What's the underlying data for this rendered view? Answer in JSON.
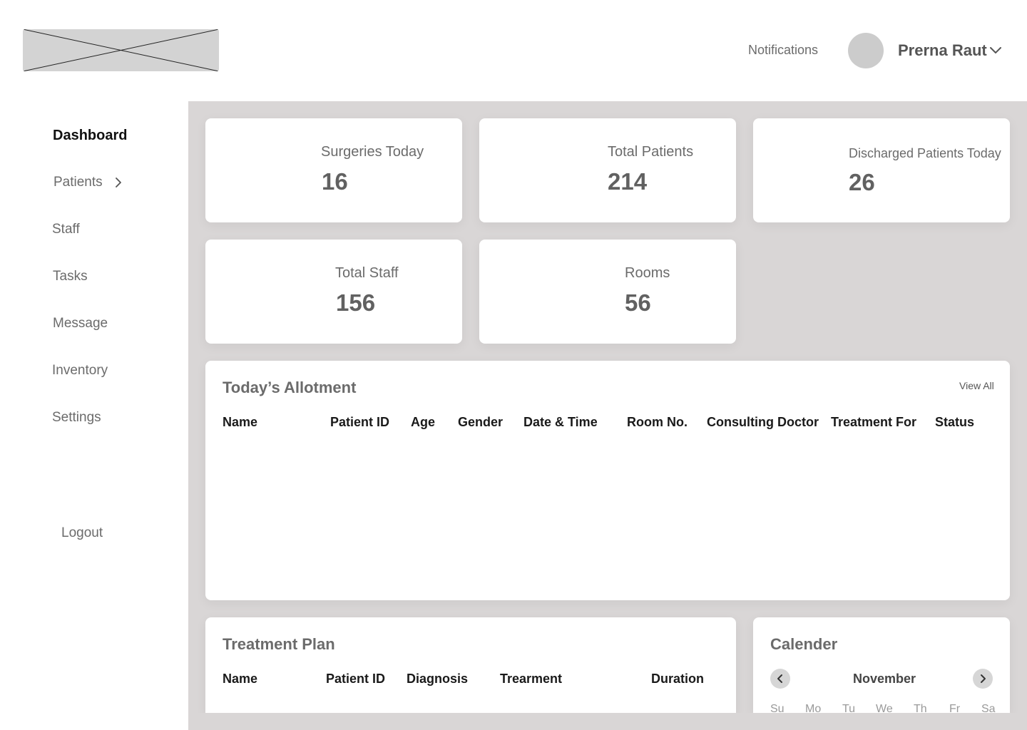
{
  "header": {
    "notifications_label": "Notifications",
    "user_name": "Prerna Raut"
  },
  "sidebar": {
    "items": [
      {
        "label": "Dashboard",
        "active": true
      },
      {
        "label": "Patients",
        "has_submenu": true
      },
      {
        "label": "Staff"
      },
      {
        "label": "Tasks"
      },
      {
        "label": "Message"
      },
      {
        "label": "Inventory"
      },
      {
        "label": "Settings"
      }
    ],
    "logout_label": "Logout"
  },
  "stats": [
    {
      "label": "Surgeries Today",
      "value": "16"
    },
    {
      "label": "Total Patients",
      "value": "214"
    },
    {
      "label": "Discharged Patients Today",
      "value": "26"
    },
    {
      "label": "Total Staff",
      "value": "156"
    },
    {
      "label": "Rooms",
      "value": "56"
    }
  ],
  "allotment": {
    "title": "Today’s Allotment",
    "view_all_label": "View All",
    "columns": [
      "Name",
      "Patient ID",
      "Age",
      "Gender",
      "Date & Time",
      "Room No.",
      "Consulting Doctor",
      "Treatment For",
      "Status"
    ]
  },
  "treatment_plan": {
    "title": "Treatment Plan",
    "columns": [
      "Name",
      "Patient ID",
      "Diagnosis",
      "Trearment",
      "Duration"
    ]
  },
  "calendar": {
    "title": "Calender",
    "month": "November",
    "weekdays": [
      "Su",
      "Mo",
      "Tu",
      "We",
      "Th",
      "Fr",
      "Sa"
    ]
  },
  "colors": {
    "main_background": "#d9d6d6",
    "card_background": "#ffffff",
    "placeholder_gray": "#d3d3d3"
  }
}
